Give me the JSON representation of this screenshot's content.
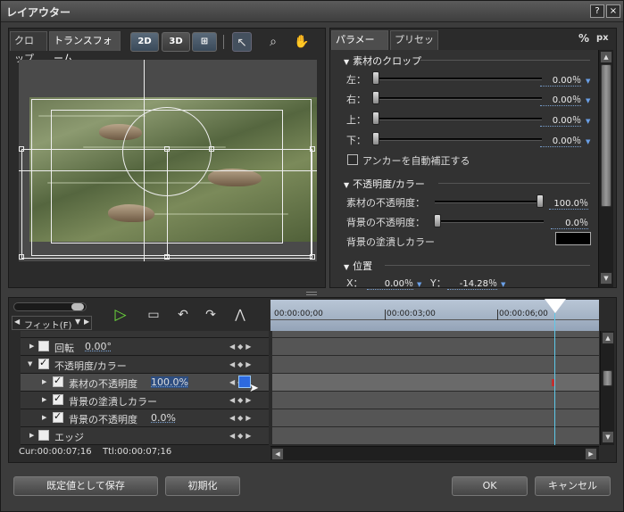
{
  "window": {
    "title": "レイアウター",
    "help_label": "?",
    "close_label": "×"
  },
  "left_tabs": [
    {
      "label": "クロップ"
    },
    {
      "label": "トランスフォーム"
    }
  ],
  "toolbar": {
    "btn_2d": "2D",
    "btn_3d": "3D"
  },
  "right_tabs": [
    {
      "label": "パラメーター"
    },
    {
      "label": "プリセット"
    }
  ],
  "units": {
    "percent": "%",
    "px": "px"
  },
  "crop": {
    "title": "素材のクロップ",
    "rows": [
      {
        "label": "左：",
        "value": "0.00％"
      },
      {
        "label": "右：",
        "value": "0.00％"
      },
      {
        "label": "上：",
        "value": "0.00％"
      },
      {
        "label": "下：",
        "value": "0.00％"
      }
    ],
    "auto_anchor_label": "アンカーを自動補正する"
  },
  "opacity": {
    "title": "不透明度/カラー",
    "material_label": "素材の不透明度：",
    "material_value": "100.0％",
    "bg_label": "背景の不透明度：",
    "bg_value": "0.0％",
    "fill_label": "背景の塗潰しカラー",
    "fill_color": "#000000"
  },
  "position": {
    "title": "位置",
    "x_label": "X：",
    "x_value": "0.00％",
    "y_label": "Y：",
    "y_value": "-14.28％"
  },
  "fit": {
    "label": "フィット(F)"
  },
  "timeline": {
    "ticks": [
      "00:00:00;00",
      "00:00:03;00",
      "00:00:06;00"
    ]
  },
  "tracks": [
    {
      "label": "回転",
      "value": "0.00°"
    },
    {
      "label": "不透明度/カラー",
      "value": ""
    },
    {
      "label": "素材の不透明度",
      "value": "100.0%"
    },
    {
      "label": "背景の塗潰しカラー",
      "value": ""
    },
    {
      "label": "背景の不透明度",
      "value": "0.0%"
    },
    {
      "label": "エッジ",
      "value": ""
    }
  ],
  "status": {
    "cur": "Cur:00:00:07;16",
    "ttl": "Ttl:00:00:07;16"
  },
  "buttons": {
    "save_default": "既定値として保存",
    "reset": "初期化",
    "ok": "OK",
    "cancel": "キャンセル"
  }
}
